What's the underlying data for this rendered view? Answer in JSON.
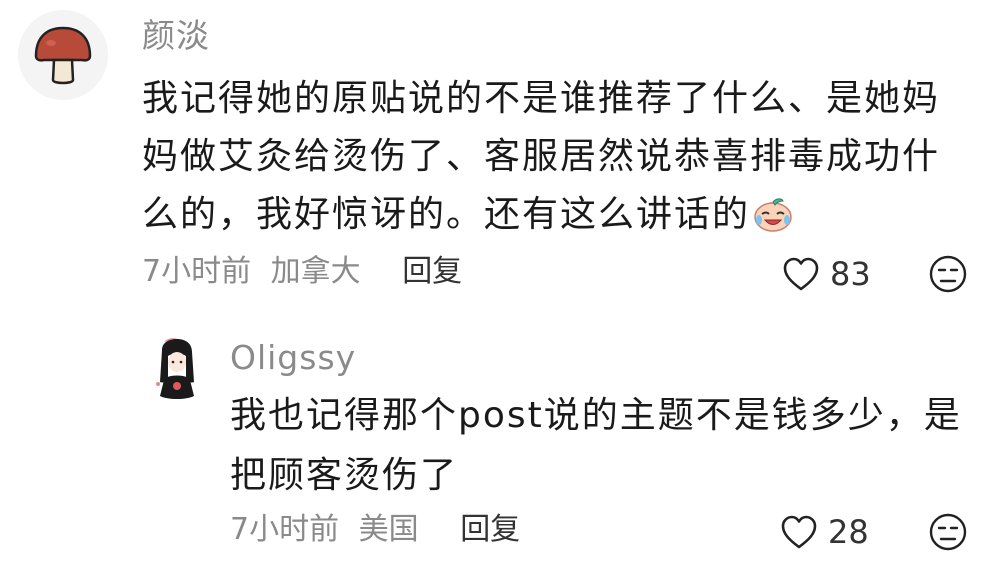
{
  "comment": {
    "username": "颜淡",
    "avatar_icon": "mushroom-icon",
    "lines": [
      "我记得她的原贴说的不是谁推荐了什么、是她妈",
      "妈做艾灸给烫伤了、客服居然说恭喜排毒成功什",
      "么的，我好惊讶的。还有这么讲话的"
    ],
    "emoji_icon": "crying-laughing-emoji-icon",
    "time": "7小时前",
    "location": "加拿大",
    "reply_label": "回复",
    "like_count": "83"
  },
  "reply": {
    "username": "Oligssy",
    "avatar_icon": "girl-illustration-avatar-icon",
    "lines": [
      "我也记得那个post说的主题不是钱多少，是",
      "把顾客烫伤了"
    ],
    "time": "7小时前",
    "location": "美国",
    "reply_label": "回复",
    "like_count": "28"
  }
}
